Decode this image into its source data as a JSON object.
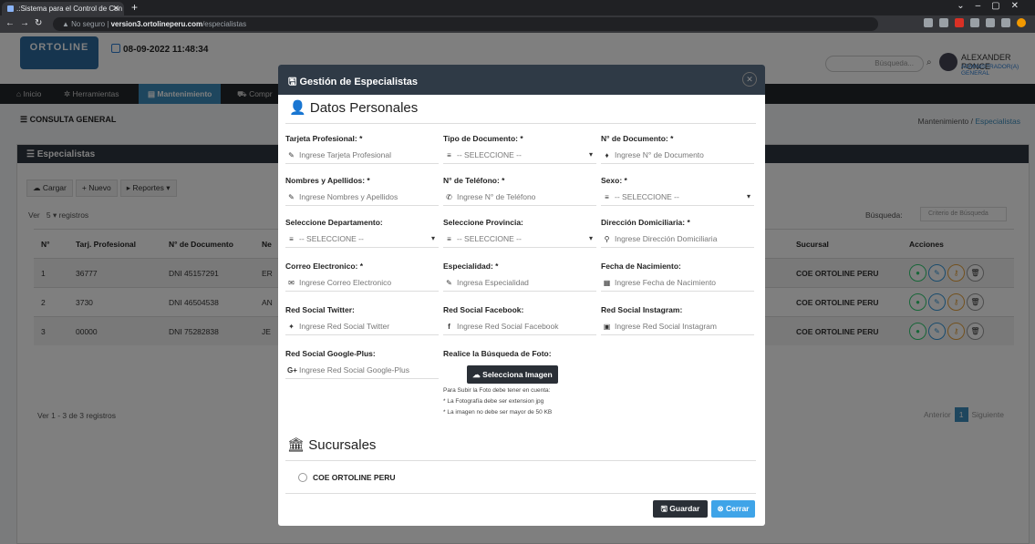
{
  "browser": {
    "tab_title": ".:Sistema para el Control de Con",
    "security": "No seguro",
    "host": "version3.ortolineperu.com",
    "path": "/especialistas"
  },
  "app": {
    "logo": "ORTOLINE",
    "datetime": "08-09-2022 11:48:34",
    "search_placeholder": "Búsqueda...",
    "user_name": "ALEXANDER PONCE",
    "user_role": "ADMINISTRADOR(A) GENERAL",
    "menu": [
      "Inicio",
      "Herramientas",
      "Mantenimiento",
      "Compr"
    ],
    "consulta": "CONSULTA GENERAL",
    "breadcrumb_root": "Mantenimiento",
    "breadcrumb_current": "Especialistas"
  },
  "panel": {
    "title": "Especialistas",
    "buttons": [
      "Cargar",
      "Nuevo",
      "Reportes"
    ],
    "ver_label": "Ver",
    "ver_value": "5",
    "registros": "registros",
    "busqueda_label": "Búsqueda:",
    "busqueda_placeholder": "Criterio de Búsqueda",
    "columns": {
      "n": "N°",
      "tarj": "Tarj. Profesional",
      "doc": "N° de Documento",
      "ne": "Ne",
      "sucursal": "Sucursal",
      "acciones": "Acciones"
    },
    "rows": [
      {
        "n": "1",
        "tarj": "36777",
        "doc": "DNI 45157291",
        "ne": "ER",
        "sucursal": "COE ORTOLINE PERU"
      },
      {
        "n": "2",
        "tarj": "3730",
        "doc": "DNI 46504538",
        "ne": "AN",
        "sucursal": "COE ORTOLINE PERU"
      },
      {
        "n": "3",
        "tarj": "00000",
        "doc": "DNI 75282838",
        "ne": "JE",
        "sucursal": "COE ORTOLINE PERU"
      }
    ],
    "footer": "Ver 1 - 3 de 3 registros",
    "prev": "Anterior",
    "page": "1",
    "next": "Siguiente"
  },
  "modal": {
    "title": "Gestión de Especialistas",
    "section_personal": "Datos Personales",
    "fields": {
      "tarjeta": {
        "label": "Tarjeta Profesional: *",
        "placeholder": "Ingrese Tarjeta Profesional"
      },
      "tipo_doc": {
        "label": "Tipo de Documento: *",
        "value": "-- SELECCIONE --"
      },
      "num_doc": {
        "label": "N° de Documento: *",
        "placeholder": "Ingrese N° de Documento"
      },
      "nombres": {
        "label": "Nombres y Apellidos: *",
        "placeholder": "Ingrese Nombres y Apellidos"
      },
      "telefono": {
        "label": "N° de Teléfono: *",
        "placeholder": "Ingrese N° de Teléfono"
      },
      "sexo": {
        "label": "Sexo: *",
        "value": "-- SELECCIONE --"
      },
      "departamento": {
        "label": "Seleccione Departamento:",
        "value": "-- SELECCIONE --"
      },
      "provincia": {
        "label": "Seleccione Provincia:",
        "value": "-- SELECCIONE --"
      },
      "direccion": {
        "label": "Dirección Domiciliaria: *",
        "placeholder": "Ingrese Dirección Domiciliaria"
      },
      "correo": {
        "label": "Correo Electronico: *",
        "placeholder": "Ingrese Correo Electronico"
      },
      "especialidad": {
        "label": "Especialidad: *",
        "placeholder": "Ingresa Especialidad"
      },
      "nacimiento": {
        "label": "Fecha de Nacimiento:",
        "placeholder": "Ingrese Fecha de Nacimiento"
      },
      "twitter": {
        "label": "Red Social Twitter:",
        "placeholder": "Ingrese Red Social Twitter"
      },
      "facebook": {
        "label": "Red Social Facebook:",
        "placeholder": "Ingrese Red Social Facebook"
      },
      "instagram": {
        "label": "Red Social Instagram:",
        "placeholder": "Ingrese Red Social Instagram"
      },
      "google": {
        "label": "Red Social Google-Plus:",
        "placeholder": "Ingrese Red Social Google-Plus"
      },
      "foto": {
        "label": "Realice la Búsqueda de Foto:",
        "button": "Selecciona Imagen"
      }
    },
    "hints": [
      "Para Subir la Foto debe tener en cuenta:",
      "* La Fotografía debe ser extension jpg",
      "* La imagen no debe ser mayor de 50 KB"
    ],
    "section_sucursales": "Sucursales",
    "sucursal_option": "COE ORTOLINE PERU",
    "save": "Guardar",
    "close": "Cerrar"
  }
}
